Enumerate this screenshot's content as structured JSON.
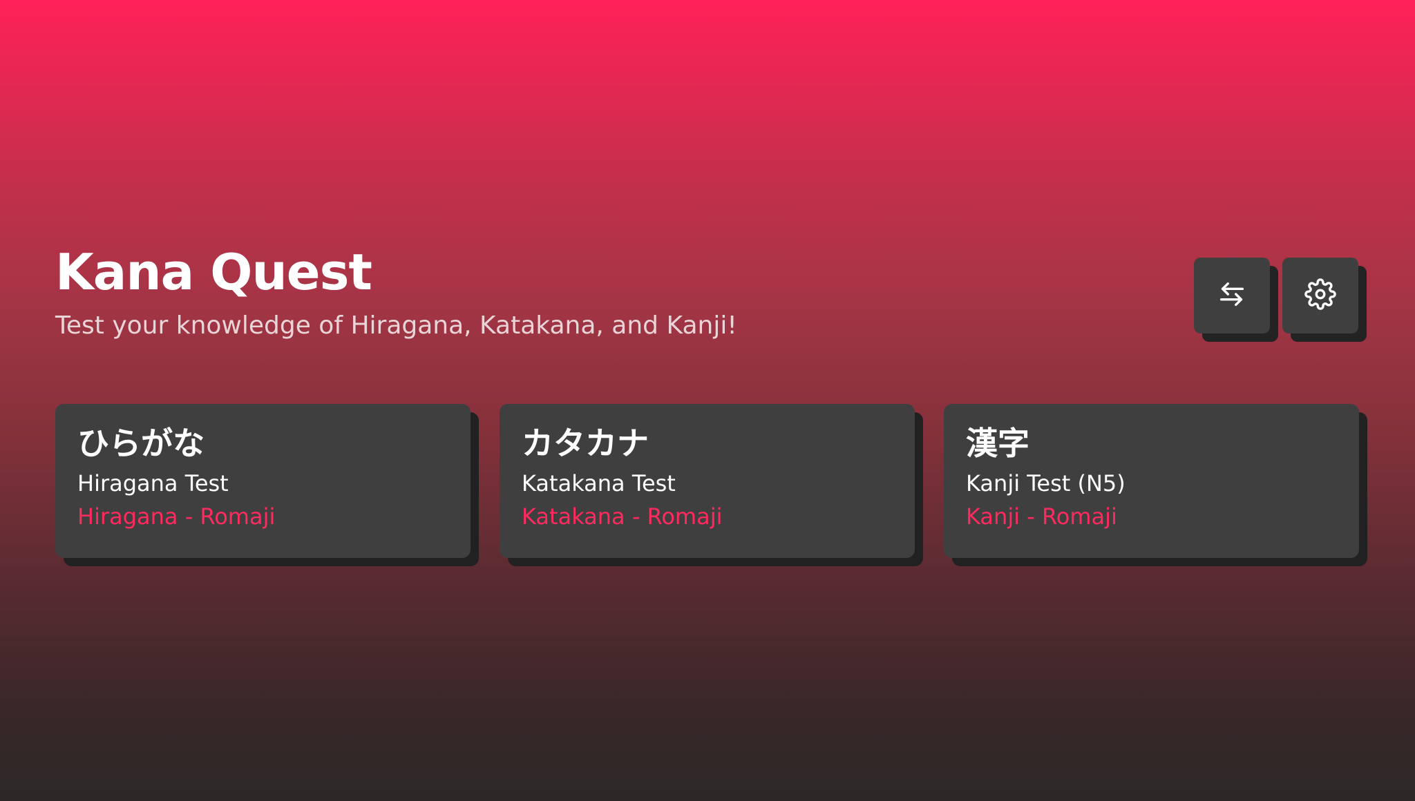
{
  "header": {
    "title": "Kana Quest",
    "subtitle": "Test your knowledge of Hiragana, Katakana, and Kanji!"
  },
  "toolbar": {
    "swap_icon": "swap-arrows-icon",
    "settings_icon": "gear-icon"
  },
  "cards": [
    {
      "jp": "ひらがな",
      "name": "Hiragana Test",
      "mode": "Hiragana - Romaji"
    },
    {
      "jp": "カタカナ",
      "name": "Katakana Test",
      "mode": "Katakana - Romaji"
    },
    {
      "jp": "漢字",
      "name": "Kanji Test (N5)",
      "mode": "Kanji - Romaji"
    }
  ],
  "colors": {
    "accent": "#ff2159",
    "card_bg": "#3f3f3f",
    "card_shadow": "#212121",
    "mode_text": "#ff2a5e"
  }
}
